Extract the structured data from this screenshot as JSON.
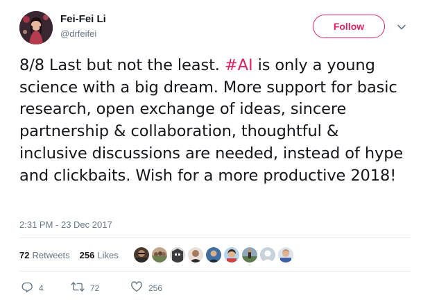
{
  "author": {
    "name": "Fei-Fei Li",
    "handle": "@drfeifei"
  },
  "follow_button": {
    "label": "Follow"
  },
  "tweet": {
    "prefix": "8/8 Last but not the least. ",
    "hashtag": "#AI",
    "body": " is only a young science with a big dream. More support for basic research, open exchange of ideas, sincere partnership & collaboration, thoughtful & inclusive discussions are needed, instead of hype and clickbaits. Wish for a more productive 2018!"
  },
  "timestamp": "2:31 PM - 23 Dec 2017",
  "stats": {
    "retweets_count": "72",
    "retweets_label": "Retweets",
    "likes_count": "256",
    "likes_label": "Likes"
  },
  "liker_avatars": [
    "avatar-1",
    "avatar-2",
    "avatar-3",
    "avatar-4",
    "avatar-5",
    "avatar-6",
    "avatar-7",
    "avatar-8",
    "avatar-9"
  ],
  "actions": {
    "reply_count": "4",
    "retweet_count": "72",
    "like_count": "256"
  },
  "colors": {
    "accent": "#e0245e",
    "secondary_text": "#657786",
    "primary_text": "#14171a",
    "divider": "#e6ecf0"
  },
  "icons": [
    "reply-icon",
    "retweet-icon",
    "heart-icon",
    "chevron-down-icon"
  ]
}
